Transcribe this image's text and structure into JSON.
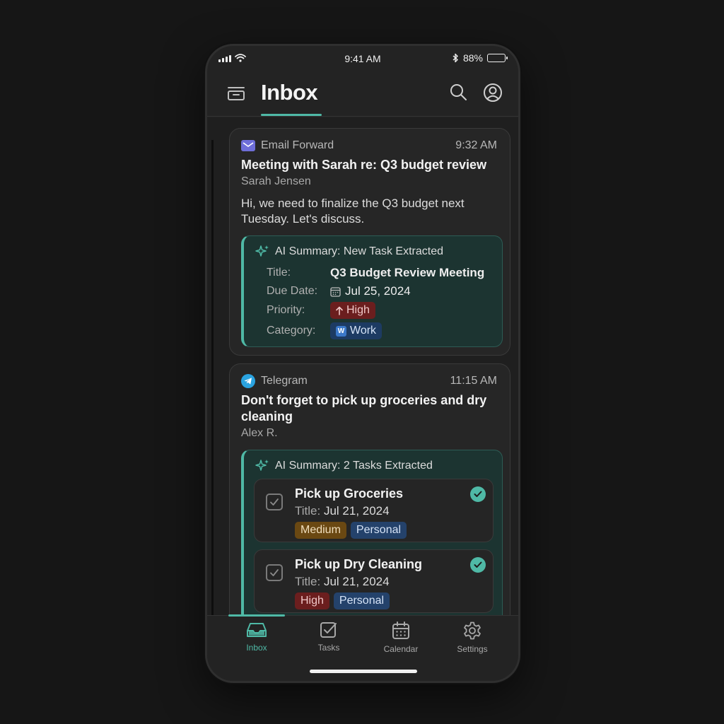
{
  "status": {
    "time": "9:41 AM",
    "battery": "88%",
    "battery_level": 0.88
  },
  "header": {
    "title": "Inbox"
  },
  "messages": [
    {
      "source": "Email Forward",
      "time": "9:32 AM",
      "title": "Meeting with Sarah re: Q3 budget review",
      "sender": "Sarah Jensen",
      "body": "Hi, we need to finalize the Q3 budget next Tuesday. Let's discuss.",
      "ai": {
        "heading": "AI Summary: New Task Extracted",
        "title_label": "Title:",
        "title_value": "Q3 Budget Review Meeting",
        "due_label": "Due Date:",
        "due_value": "Jul 25, 2024",
        "priority_label": "Priority:",
        "priority_value": "High",
        "category_label": "Category:",
        "category_value": "Work",
        "category_icon_letter": "W"
      }
    },
    {
      "source": "Telegram",
      "time": "11:15 AM",
      "title": "Don't forget to pick up groceries and dry cleaning",
      "sender": "Alex R.",
      "ai": {
        "heading": "AI Summary: 2 Tasks Extracted",
        "tasks": [
          {
            "title": "Pick up Groceries",
            "date_label": "Title:",
            "date": "Jul 21, 2024",
            "priority": "Medium",
            "category": "Personal"
          },
          {
            "title": "Pick up Dry Cleaning",
            "date_label": "Title:",
            "date": "Jul 21, 2024",
            "priority": "High",
            "category": "Personal"
          }
        ]
      }
    }
  ],
  "tabs": [
    {
      "label": "Inbox",
      "icon": "inbox-icon",
      "active": true
    },
    {
      "label": "Tasks",
      "icon": "tasks-icon",
      "active": false
    },
    {
      "label": "Calendar",
      "icon": "calendar-icon",
      "active": false
    },
    {
      "label": "Settings",
      "icon": "settings-icon",
      "active": false
    }
  ],
  "colors": {
    "accent": "#4fb9a6",
    "background": "#161616",
    "surface": "#262626",
    "ai_surface": "#1c3431",
    "badge_high": "#6b1e1e",
    "badge_medium": "#6a4812",
    "badge_personal": "#24426b",
    "badge_work": "#1d3b63"
  }
}
